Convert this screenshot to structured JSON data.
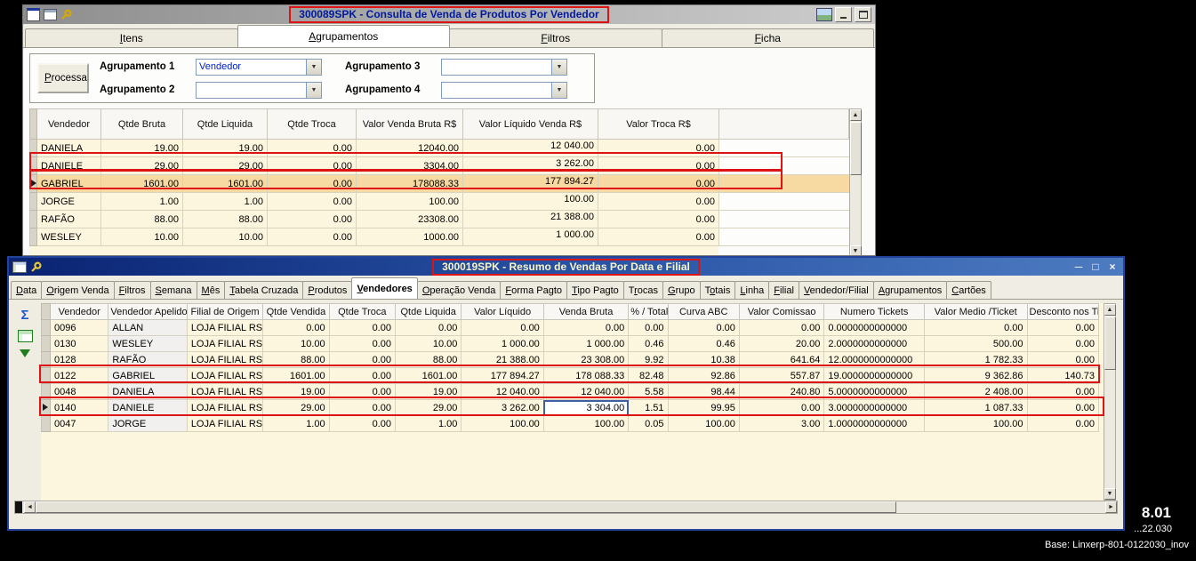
{
  "desktop": {
    "version_big": "8.01",
    "version_small": "...22.030",
    "base_label": "Base: Linxerp-801-0122030_inov"
  },
  "icons": {
    "minimize": "─",
    "maximize": "□",
    "close": "×",
    "sum": "Σ",
    "combo_arrow": "▼",
    "row_indicator": "▶",
    "scroll_up": "▲",
    "scroll_down": "▼",
    "scroll_left": "◄",
    "scroll_right": "►"
  },
  "window1": {
    "title": "300089SPK - Consulta de Venda de Produtos Por Vendedor",
    "tabs": [
      {
        "label": "Itens",
        "hotkey": 0,
        "active": false
      },
      {
        "label": "Agrupamentos",
        "hotkey": 0,
        "active": true
      },
      {
        "label": "Filtros",
        "hotkey": 0,
        "active": false
      },
      {
        "label": "Ficha",
        "hotkey": 0,
        "active": false
      }
    ],
    "form": {
      "process_button": "Processa",
      "process_hotkey": 0,
      "fields": [
        {
          "label": "Agrupamento 1",
          "value": "Vendedor"
        },
        {
          "label": "Agrupamento 2",
          "value": ""
        },
        {
          "label": "Agrupamento 3",
          "value": ""
        },
        {
          "label": "Agrupamento 4",
          "value": ""
        }
      ]
    },
    "grid": {
      "columns": [
        "Vendedor",
        "Qtde Bruta",
        "Qtde Liquida",
        "Qtde Troca",
        "Valor Venda Bruta R$",
        "Valor Líquido Venda R$",
        "Valor Troca R$"
      ],
      "rows": [
        [
          "DANIELA",
          "19.00",
          "19.00",
          "0.00",
          "12040.00",
          "12 040.00",
          "0.00"
        ],
        [
          "DANIELE",
          "29.00",
          "29.00",
          "0.00",
          "3304.00",
          "3 262.00",
          "0.00"
        ],
        [
          "GABRIEL",
          "1601.00",
          "1601.00",
          "0.00",
          "178088.33",
          "177 894.27",
          "0.00"
        ],
        [
          "JORGE",
          "1.00",
          "1.00",
          "0.00",
          "100.00",
          "100.00",
          "0.00"
        ],
        [
          "RAFÃO",
          "88.00",
          "88.00",
          "0.00",
          "23308.00",
          "21 388.00",
          "0.00"
        ],
        [
          "WESLEY",
          "10.00",
          "10.00",
          "0.00",
          "1000.00",
          "1 000.00",
          "0.00"
        ]
      ],
      "selected_row": 2,
      "indicator_row": 2
    }
  },
  "window2": {
    "title": "300019SPK - Resumo de Vendas Por Data e Filial",
    "tabs": [
      {
        "label": "Data",
        "hotkey": 0,
        "active": false
      },
      {
        "label": "Origem Venda",
        "hotkey": 0,
        "active": false
      },
      {
        "label": "Filtros",
        "hotkey": 0,
        "active": false
      },
      {
        "label": "Semana",
        "hotkey": 0,
        "active": false
      },
      {
        "label": "Mês",
        "hotkey": 0,
        "active": false
      },
      {
        "label": "Tabela Cruzada",
        "hotkey": 0,
        "active": false
      },
      {
        "label": "Produtos",
        "hotkey": 0,
        "active": false
      },
      {
        "label": "Vendedores",
        "hotkey": 0,
        "active": true
      },
      {
        "label": "Operação Venda",
        "hotkey": 0,
        "active": false
      },
      {
        "label": "Forma Pagto",
        "hotkey": 0,
        "active": false
      },
      {
        "label": "Tipo Pagto",
        "hotkey": 0,
        "active": false
      },
      {
        "label": "Trocas",
        "hotkey": 1,
        "active": false
      },
      {
        "label": "Grupo",
        "hotkey": 0,
        "active": false
      },
      {
        "label": "Totais",
        "hotkey": 1,
        "active": false
      },
      {
        "label": "Linha",
        "hotkey": 0,
        "active": false
      },
      {
        "label": "Filial",
        "hotkey": 0,
        "active": false
      },
      {
        "label": "Vendedor/Filial",
        "hotkey": 0,
        "active": false
      },
      {
        "label": "Agrupamentos",
        "hotkey": 0,
        "active": false
      },
      {
        "label": "Cartões",
        "hotkey": 0,
        "active": false
      }
    ],
    "grid": {
      "columns": [
        "Vendedor",
        "Vendedor Apelido",
        "Filial de Origem",
        "Qtde Vendida",
        "Qtde Troca",
        "Qtde Liquida",
        "Valor Líquido",
        "Venda Bruta",
        "% / Total",
        "Curva ABC",
        "Valor Comissao",
        "Numero Tickets",
        "Valor Medio /Ticket",
        "Desconto nos Tick"
      ],
      "rows": [
        [
          "0096",
          "ALLAN",
          "LOJA FILIAL RS",
          "0.00",
          "0.00",
          "0.00",
          "0.00",
          "0.00",
          "0.00",
          "0.00",
          "0.00",
          "0.0000000000000",
          "0.00",
          "0.00"
        ],
        [
          "0130",
          "WESLEY",
          "LOJA FILIAL RS",
          "10.00",
          "0.00",
          "10.00",
          "1 000.00",
          "1 000.00",
          "0.46",
          "0.46",
          "20.00",
          "2.0000000000000",
          "500.00",
          "0.00"
        ],
        [
          "0128",
          "RAFÃO",
          "LOJA FILIAL RS",
          "88.00",
          "0.00",
          "88.00",
          "21 388.00",
          "23 308.00",
          "9.92",
          "10.38",
          "641.64",
          "12.0000000000000",
          "1 782.33",
          "0.00"
        ],
        [
          "0122",
          "GABRIEL",
          "LOJA FILIAL RS",
          "1601.00",
          "0.00",
          "1601.00",
          "177 894.27",
          "178 088.33",
          "82.48",
          "92.86",
          "557.87",
          "19.0000000000000",
          "9 362.86",
          "140.73"
        ],
        [
          "0048",
          "DANIELA",
          "LOJA FILIAL RS",
          "19.00",
          "0.00",
          "19.00",
          "12 040.00",
          "12 040.00",
          "5.58",
          "98.44",
          "240.80",
          "5.0000000000000",
          "2 408.00",
          "0.00"
        ],
        [
          "0140",
          "DANIELE",
          "LOJA FILIAL RS",
          "29.00",
          "0.00",
          "29.00",
          "3 262.00",
          "3 304.00",
          "1.51",
          "99.95",
          "0.00",
          "3.0000000000000",
          "1 087.33",
          "0.00"
        ],
        [
          "0047",
          "JORGE",
          "LOJA FILIAL RS",
          "1.00",
          "0.00",
          "1.00",
          "100.00",
          "100.00",
          "0.05",
          "100.00",
          "3.00",
          "1.0000000000000",
          "100.00",
          "0.00"
        ]
      ],
      "indicator_row": 5,
      "active_cell": {
        "row": 5,
        "col": 7
      }
    }
  }
}
